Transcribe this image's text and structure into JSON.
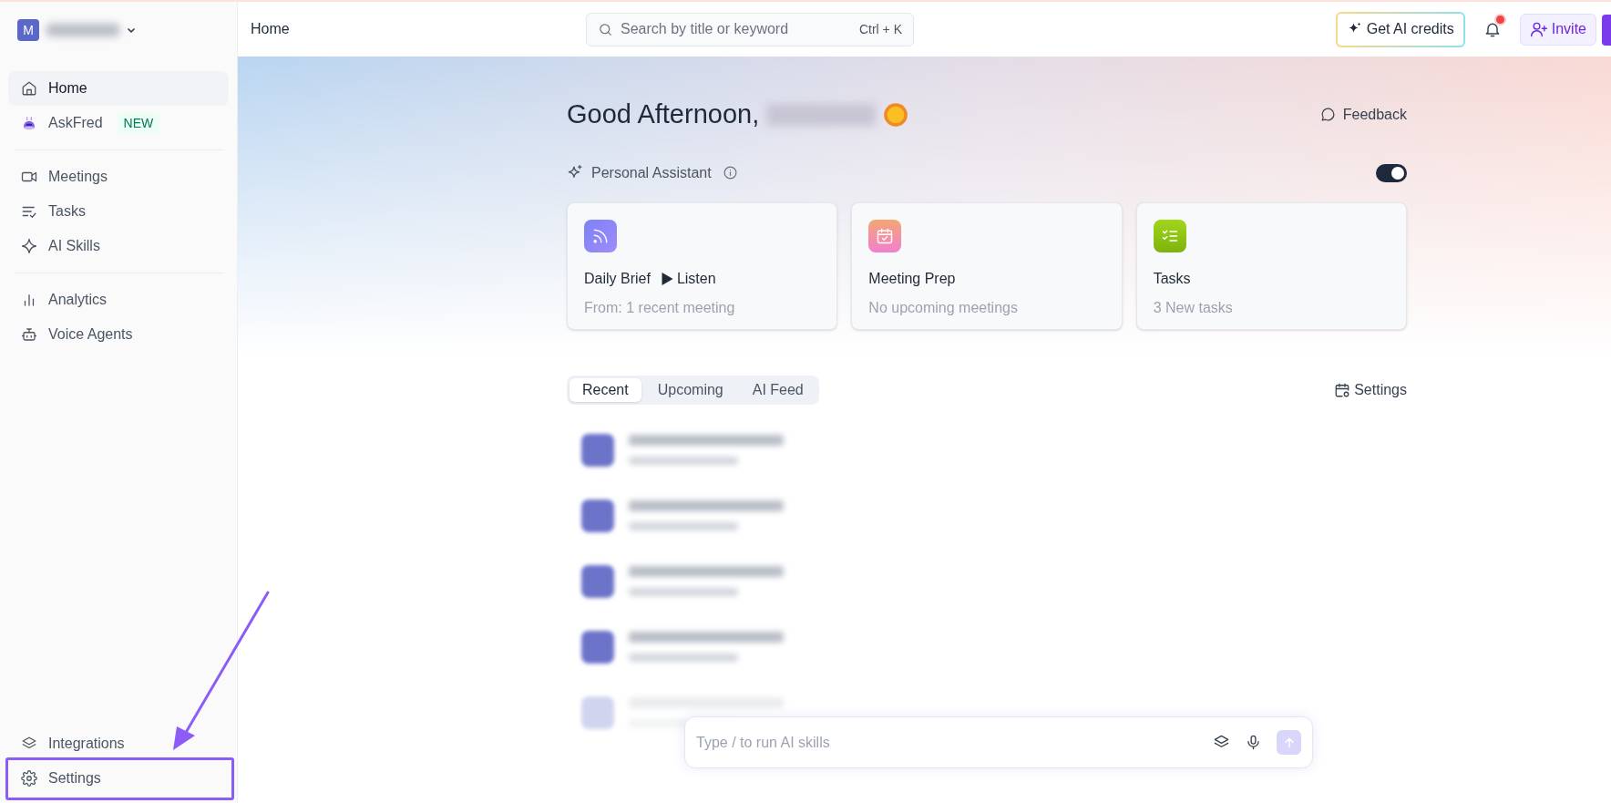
{
  "workspace": {
    "avatar_letter": "M"
  },
  "sidebar": {
    "groups": [
      [
        {
          "label": "Home",
          "kind": "home",
          "selected": true
        },
        {
          "label": "AskFred",
          "kind": "bot",
          "badge": "NEW",
          "selected": false
        }
      ],
      [
        {
          "label": "Meetings",
          "kind": "video",
          "selected": false
        },
        {
          "label": "Tasks",
          "kind": "tasks",
          "selected": false
        },
        {
          "label": "AI Skills",
          "kind": "sparkle",
          "selected": false
        }
      ],
      [
        {
          "label": "Analytics",
          "kind": "chart",
          "selected": false
        },
        {
          "label": "Voice Agents",
          "kind": "robot",
          "selected": false
        }
      ]
    ],
    "footer_items": [
      {
        "label": "Integrations",
        "kind": "layers",
        "selected": false,
        "highlighted": false
      },
      {
        "label": "Settings",
        "kind": "gear",
        "selected": false,
        "highlighted": true
      }
    ]
  },
  "topbar": {
    "title": "Home",
    "search": {
      "placeholder": "Search by title or keyword",
      "shortcut": "Ctrl + K"
    },
    "credits_button": "Get AI credits",
    "notification_dot": true,
    "invite_button": "Invite"
  },
  "greeting": "Good Afternoon,",
  "feedback": "Feedback",
  "assistant": {
    "label": "Personal Assistant",
    "on": true
  },
  "cards": [
    {
      "kind": "brief",
      "title": "Daily Brief",
      "action": "Listen",
      "subtitle": "From: 1 recent meeting"
    },
    {
      "kind": "prep",
      "title": "Meeting Prep",
      "subtitle": "No upcoming meetings"
    },
    {
      "kind": "tasks",
      "title": "Tasks",
      "subtitle": "3 New tasks"
    }
  ],
  "tabs": [
    {
      "label": "Recent",
      "selected": true
    },
    {
      "label": "Upcoming",
      "selected": false
    },
    {
      "label": "AI Feed",
      "selected": false
    }
  ],
  "settings_link": "Settings",
  "meetings": [
    {
      "kind": "redacted"
    },
    {
      "kind": "redacted"
    },
    {
      "kind": "redacted"
    },
    {
      "kind": "redacted"
    },
    {
      "kind": "faded"
    }
  ],
  "composer": {
    "placeholder": "Type / to run AI skills"
  }
}
